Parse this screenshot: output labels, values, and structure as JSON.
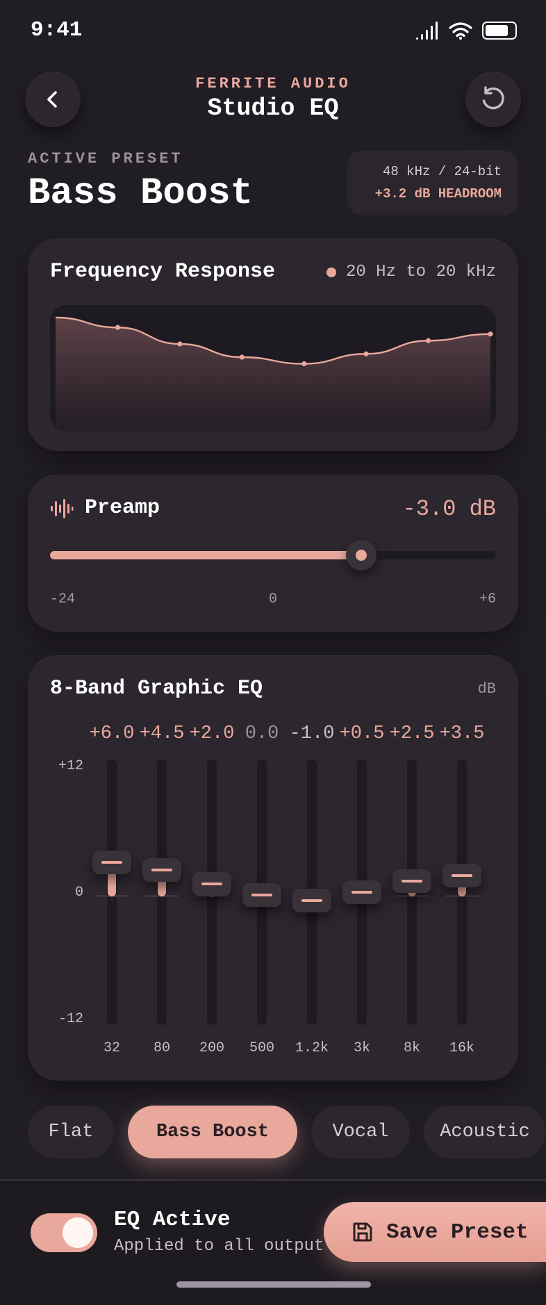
{
  "status_bar": {
    "time": "9:41"
  },
  "header": {
    "brand": "FERRITE AUDIO",
    "title": "Studio EQ"
  },
  "preset": {
    "caption": "ACTIVE PRESET",
    "name": "Bass Boost",
    "format": "48 kHz / 24-bit",
    "headroom": "+3.2 dB HEADROOM"
  },
  "frequency_response": {
    "title": "Frequency Response",
    "range": "20 Hz to 20 kHz"
  },
  "preamp": {
    "title": "Preamp",
    "value_label": "-3.0 dB",
    "value": -3.0,
    "min": -24,
    "max": 6,
    "scale": {
      "min_label": "-24",
      "mid_label": "0",
      "max_label": "+6"
    }
  },
  "eq": {
    "title": "8-Band Graphic EQ",
    "unit": "dB",
    "axis": {
      "top": "+12",
      "mid": "0",
      "bottom": "-12"
    },
    "range": [
      -12,
      12
    ],
    "bands": [
      {
        "freq": "32",
        "value_label": "+6.0",
        "value": 6.0
      },
      {
        "freq": "80",
        "value_label": "+4.5",
        "value": 4.5
      },
      {
        "freq": "200",
        "value_label": "+2.0",
        "value": 2.0
      },
      {
        "freq": "500",
        "value_label": "0.0",
        "value": 0.0
      },
      {
        "freq": "1.2k",
        "value_label": "-1.0",
        "value": -1.0
      },
      {
        "freq": "3k",
        "value_label": "+0.5",
        "value": 0.5
      },
      {
        "freq": "8k",
        "value_label": "+2.5",
        "value": 2.5
      },
      {
        "freq": "16k",
        "value_label": "+3.5",
        "value": 3.5
      }
    ]
  },
  "preset_chips": [
    "Flat",
    "Bass Boost",
    "Vocal",
    "Acoustic"
  ],
  "active_chip": "Bass Boost",
  "footer": {
    "toggle_title": "EQ Active",
    "toggle_subtitle": "Applied to all output",
    "toggle_on": true,
    "save_label": "Save Preset"
  },
  "colors": {
    "accent": "#e9a89c",
    "background": "#211d24",
    "card": "#2c262e",
    "well": "#1e1a21"
  }
}
